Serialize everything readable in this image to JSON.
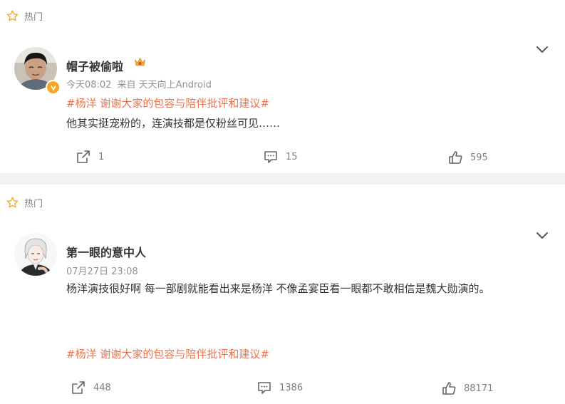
{
  "comments": [
    {
      "hot_label": "热门",
      "username": "帽子被偷啦",
      "time": "今天08:02",
      "source": "来自 天天向上Android",
      "topic": "#杨洋 谢谢大家的包容与陪伴批评和建议#",
      "text": "他其实挺宠粉的，连演技都是仅粉丝可见……",
      "reposts": "1",
      "comments_count": "15",
      "likes": "595"
    },
    {
      "hot_label": "热门",
      "username": "第一眼的意中人",
      "time": "07月27日 23:08",
      "text": "杨洋演技很好啊 每一部剧就能看出来是杨洋 不像孟宴臣看一眼都不敢相信是魏大勋演的。",
      "topic": "#杨洋 谢谢大家的包容与陪伴批评和建议#",
      "reposts": "448",
      "comments_count": "1386",
      "likes": "88171"
    }
  ],
  "colors": {
    "topic": "#eb7350",
    "hot_star": "#f5a623",
    "meta": "#939393",
    "separator": "#f2f2f2"
  },
  "icons": {
    "hot": "star-outline-icon",
    "expand": "chevron-down-icon",
    "repost": "share-icon",
    "comment": "comment-icon",
    "like": "thumbs-up-icon",
    "verified": "verified-badge-icon",
    "member": "crown-badge-icon"
  }
}
